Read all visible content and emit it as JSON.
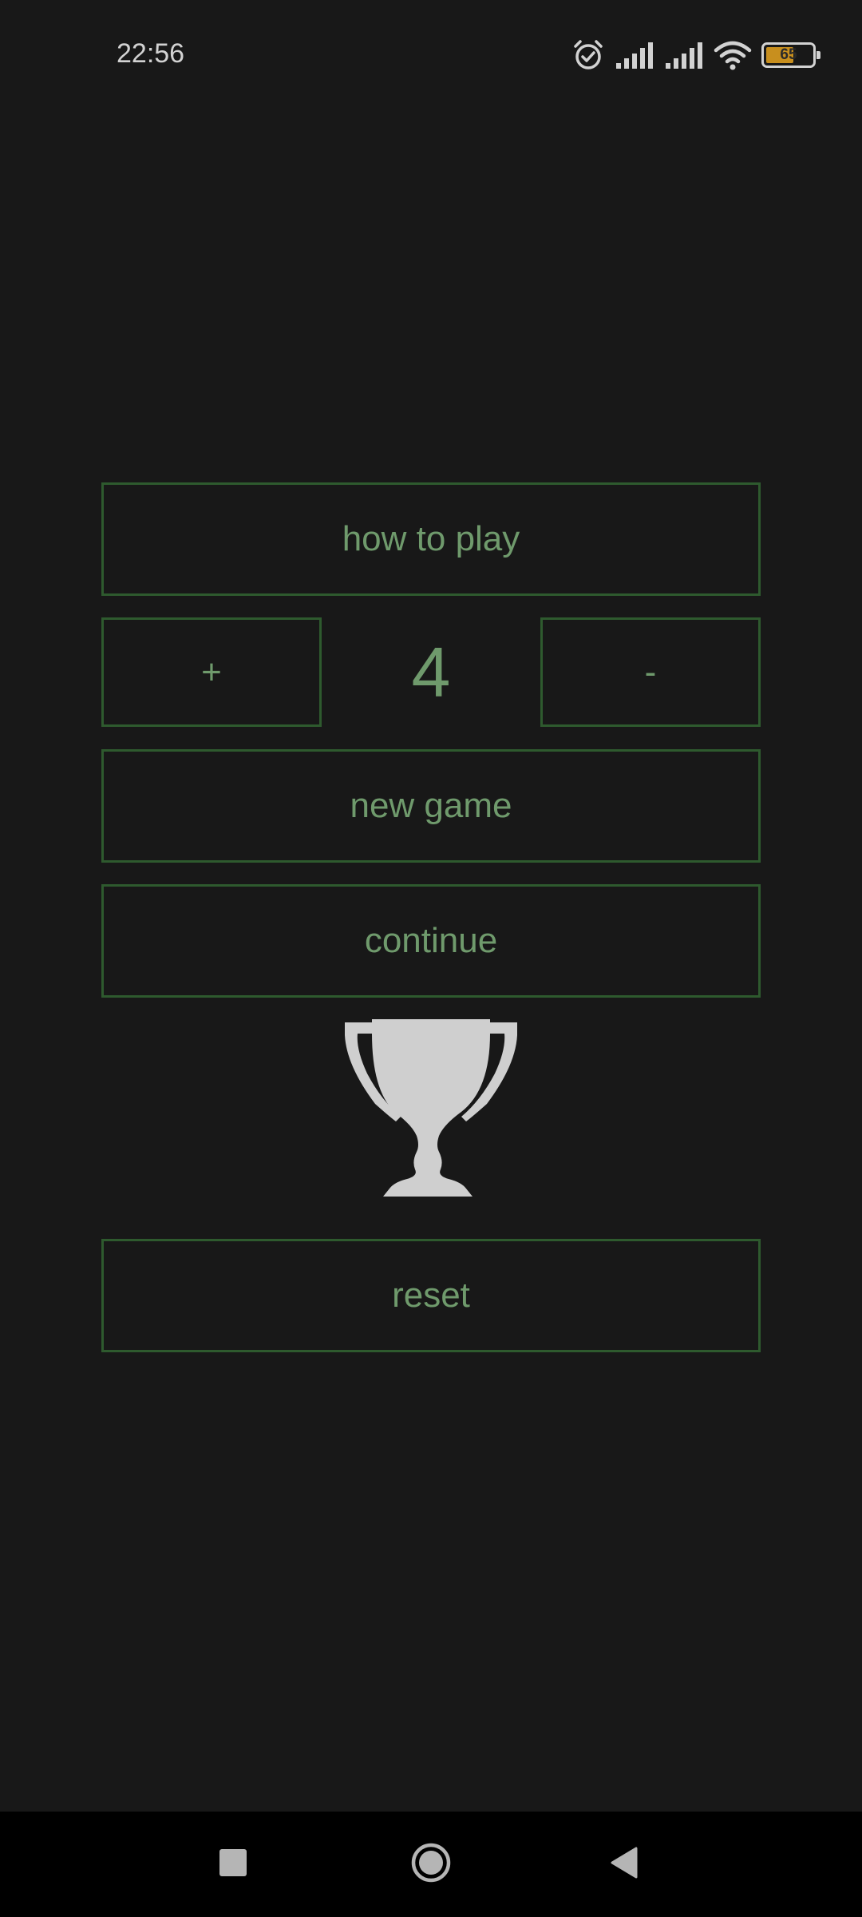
{
  "status_bar": {
    "time": "22:56",
    "battery_level": "65",
    "battery_percent": 65,
    "icons": [
      "alarm-icon",
      "signal-icon",
      "signal-icon",
      "wifi-icon",
      "battery-icon"
    ]
  },
  "menu": {
    "how_to_play": "how to play",
    "increment": "+",
    "count": "4",
    "decrement": "-",
    "new_game": "new game",
    "continue": "continue",
    "reset": "reset"
  },
  "trophy": {
    "icon": "trophy-icon",
    "color": "#cfcfcf"
  },
  "nav_bar": {
    "recents": "square-icon",
    "home": "circle-icon",
    "back": "triangle-back-icon"
  },
  "colors": {
    "background": "#181818",
    "accent_text": "#6f9a6c",
    "button_border": "#2e5a2e",
    "battery": "#c88f1e"
  }
}
